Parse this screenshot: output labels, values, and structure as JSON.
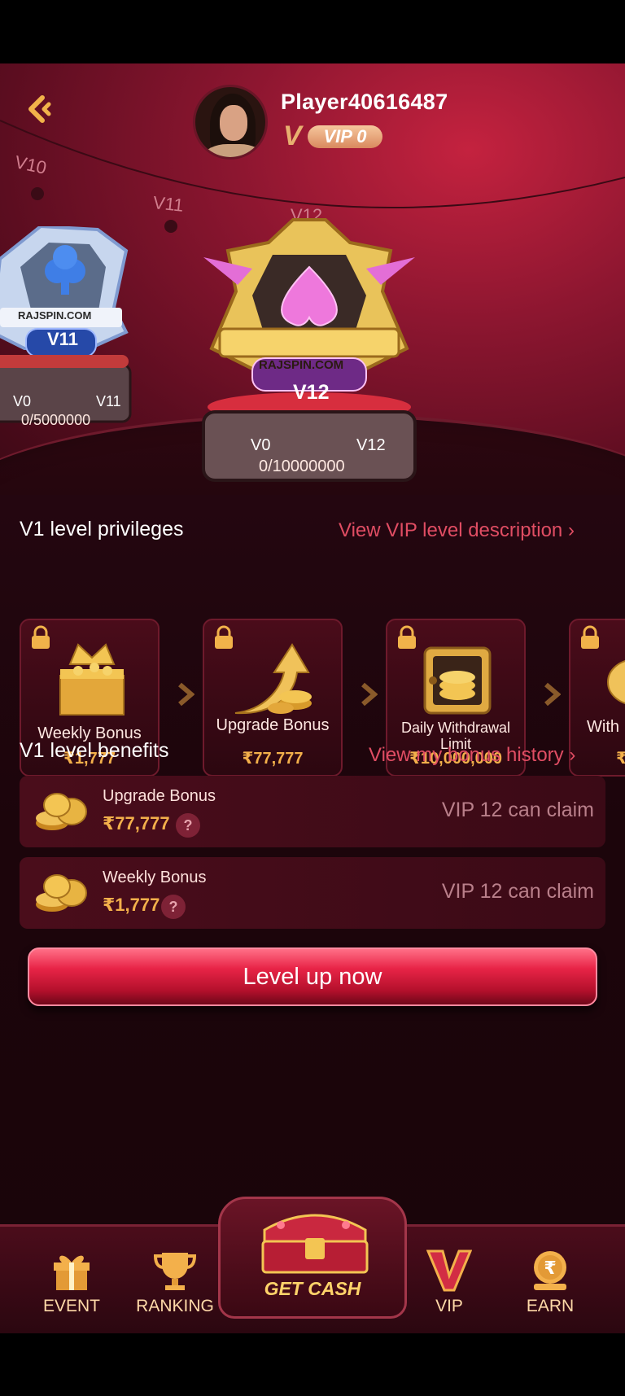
{
  "header": {
    "player_name": "Player40616487",
    "vip_badge": "VIP 0"
  },
  "track": {
    "levels": [
      "V10",
      "V11",
      "V12"
    ],
    "current": "V12"
  },
  "badges": {
    "left": {
      "level": "V11",
      "brand": "RAJSPIN.COM",
      "from": "V0",
      "to": "V11",
      "progress": "0/5000000"
    },
    "center": {
      "level": "V12",
      "brand": "RAJSPIN.COM",
      "from": "V0",
      "to": "V12",
      "progress": "0/10000000"
    }
  },
  "privileges": {
    "title": "V1 level privileges",
    "link": "View VIP level description",
    "cards": [
      {
        "label": "Weekly Bonus",
        "value": "₹1,777",
        "icon": "gift-box-crown-icon"
      },
      {
        "label": "Upgrade Bonus",
        "value": "₹77,777",
        "icon": "upgrade-arrow-coins-icon"
      },
      {
        "label": "Daily Withdrawal Limit",
        "value": "₹10,000,000",
        "icon": "safe-icon"
      },
      {
        "label": "With",
        "value": "₹",
        "icon": "piggy-bank-icon"
      }
    ]
  },
  "benefits": {
    "title": "V1 level benefits",
    "link": "View my bonus history",
    "rows": [
      {
        "name": "Upgrade Bonus",
        "amount": "₹77,777",
        "claim": "VIP 12 can claim"
      },
      {
        "name": "Weekly Bonus",
        "amount": "₹1,777",
        "claim": "VIP 12 can claim"
      }
    ],
    "help_glyph": "?"
  },
  "actions": {
    "level_up": "Level up now"
  },
  "nav": {
    "event": "EVENT",
    "ranking": "RANKING",
    "get_cash": "GET CASH",
    "vip": "VIP",
    "earn": "EARN"
  },
  "colors": {
    "accent_red": "#e82447",
    "gold": "#f3b04b",
    "link_red": "#e04d63"
  }
}
